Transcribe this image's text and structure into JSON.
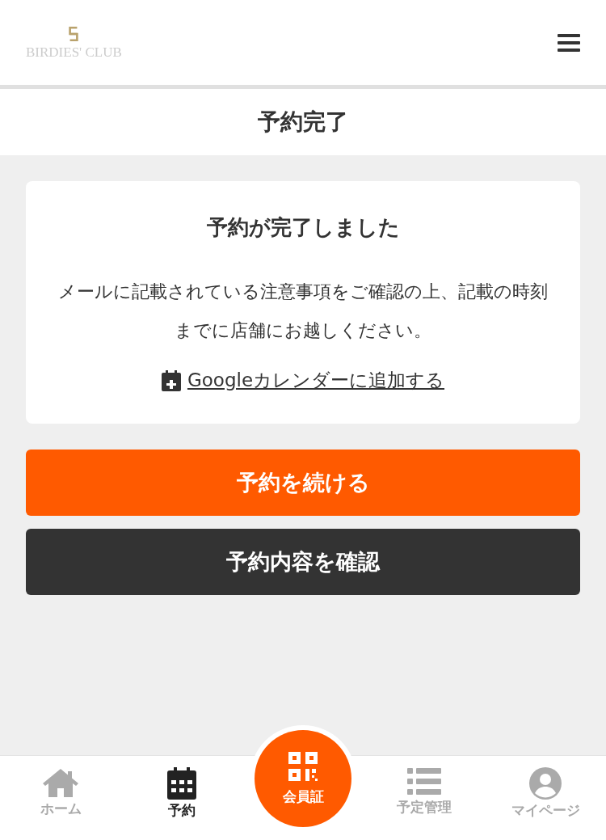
{
  "header": {
    "logo": "BIRDIES' CLUB"
  },
  "page_title": "予約完了",
  "card": {
    "heading": "予約が完了しました",
    "message": "メールに記載されている注意事項をご確認の上、記載の時刻までに店舗にお越しください。",
    "calendar_link": "Googleカレンダーに追加する"
  },
  "buttons": [
    {
      "label": "予約を続ける",
      "kind": "primary"
    },
    {
      "label": "予約内容を確認",
      "kind": "secondary"
    }
  ],
  "nav": [
    {
      "label": "ホーム",
      "kind": "home",
      "selected": false
    },
    {
      "label": "予約",
      "kind": "calendar",
      "selected": true
    },
    {
      "label": "会員証",
      "kind": "qr",
      "selected": false
    },
    {
      "label": "予定管理",
      "kind": "list",
      "selected": false
    },
    {
      "label": "マイページ",
      "kind": "user",
      "selected": false
    }
  ]
}
